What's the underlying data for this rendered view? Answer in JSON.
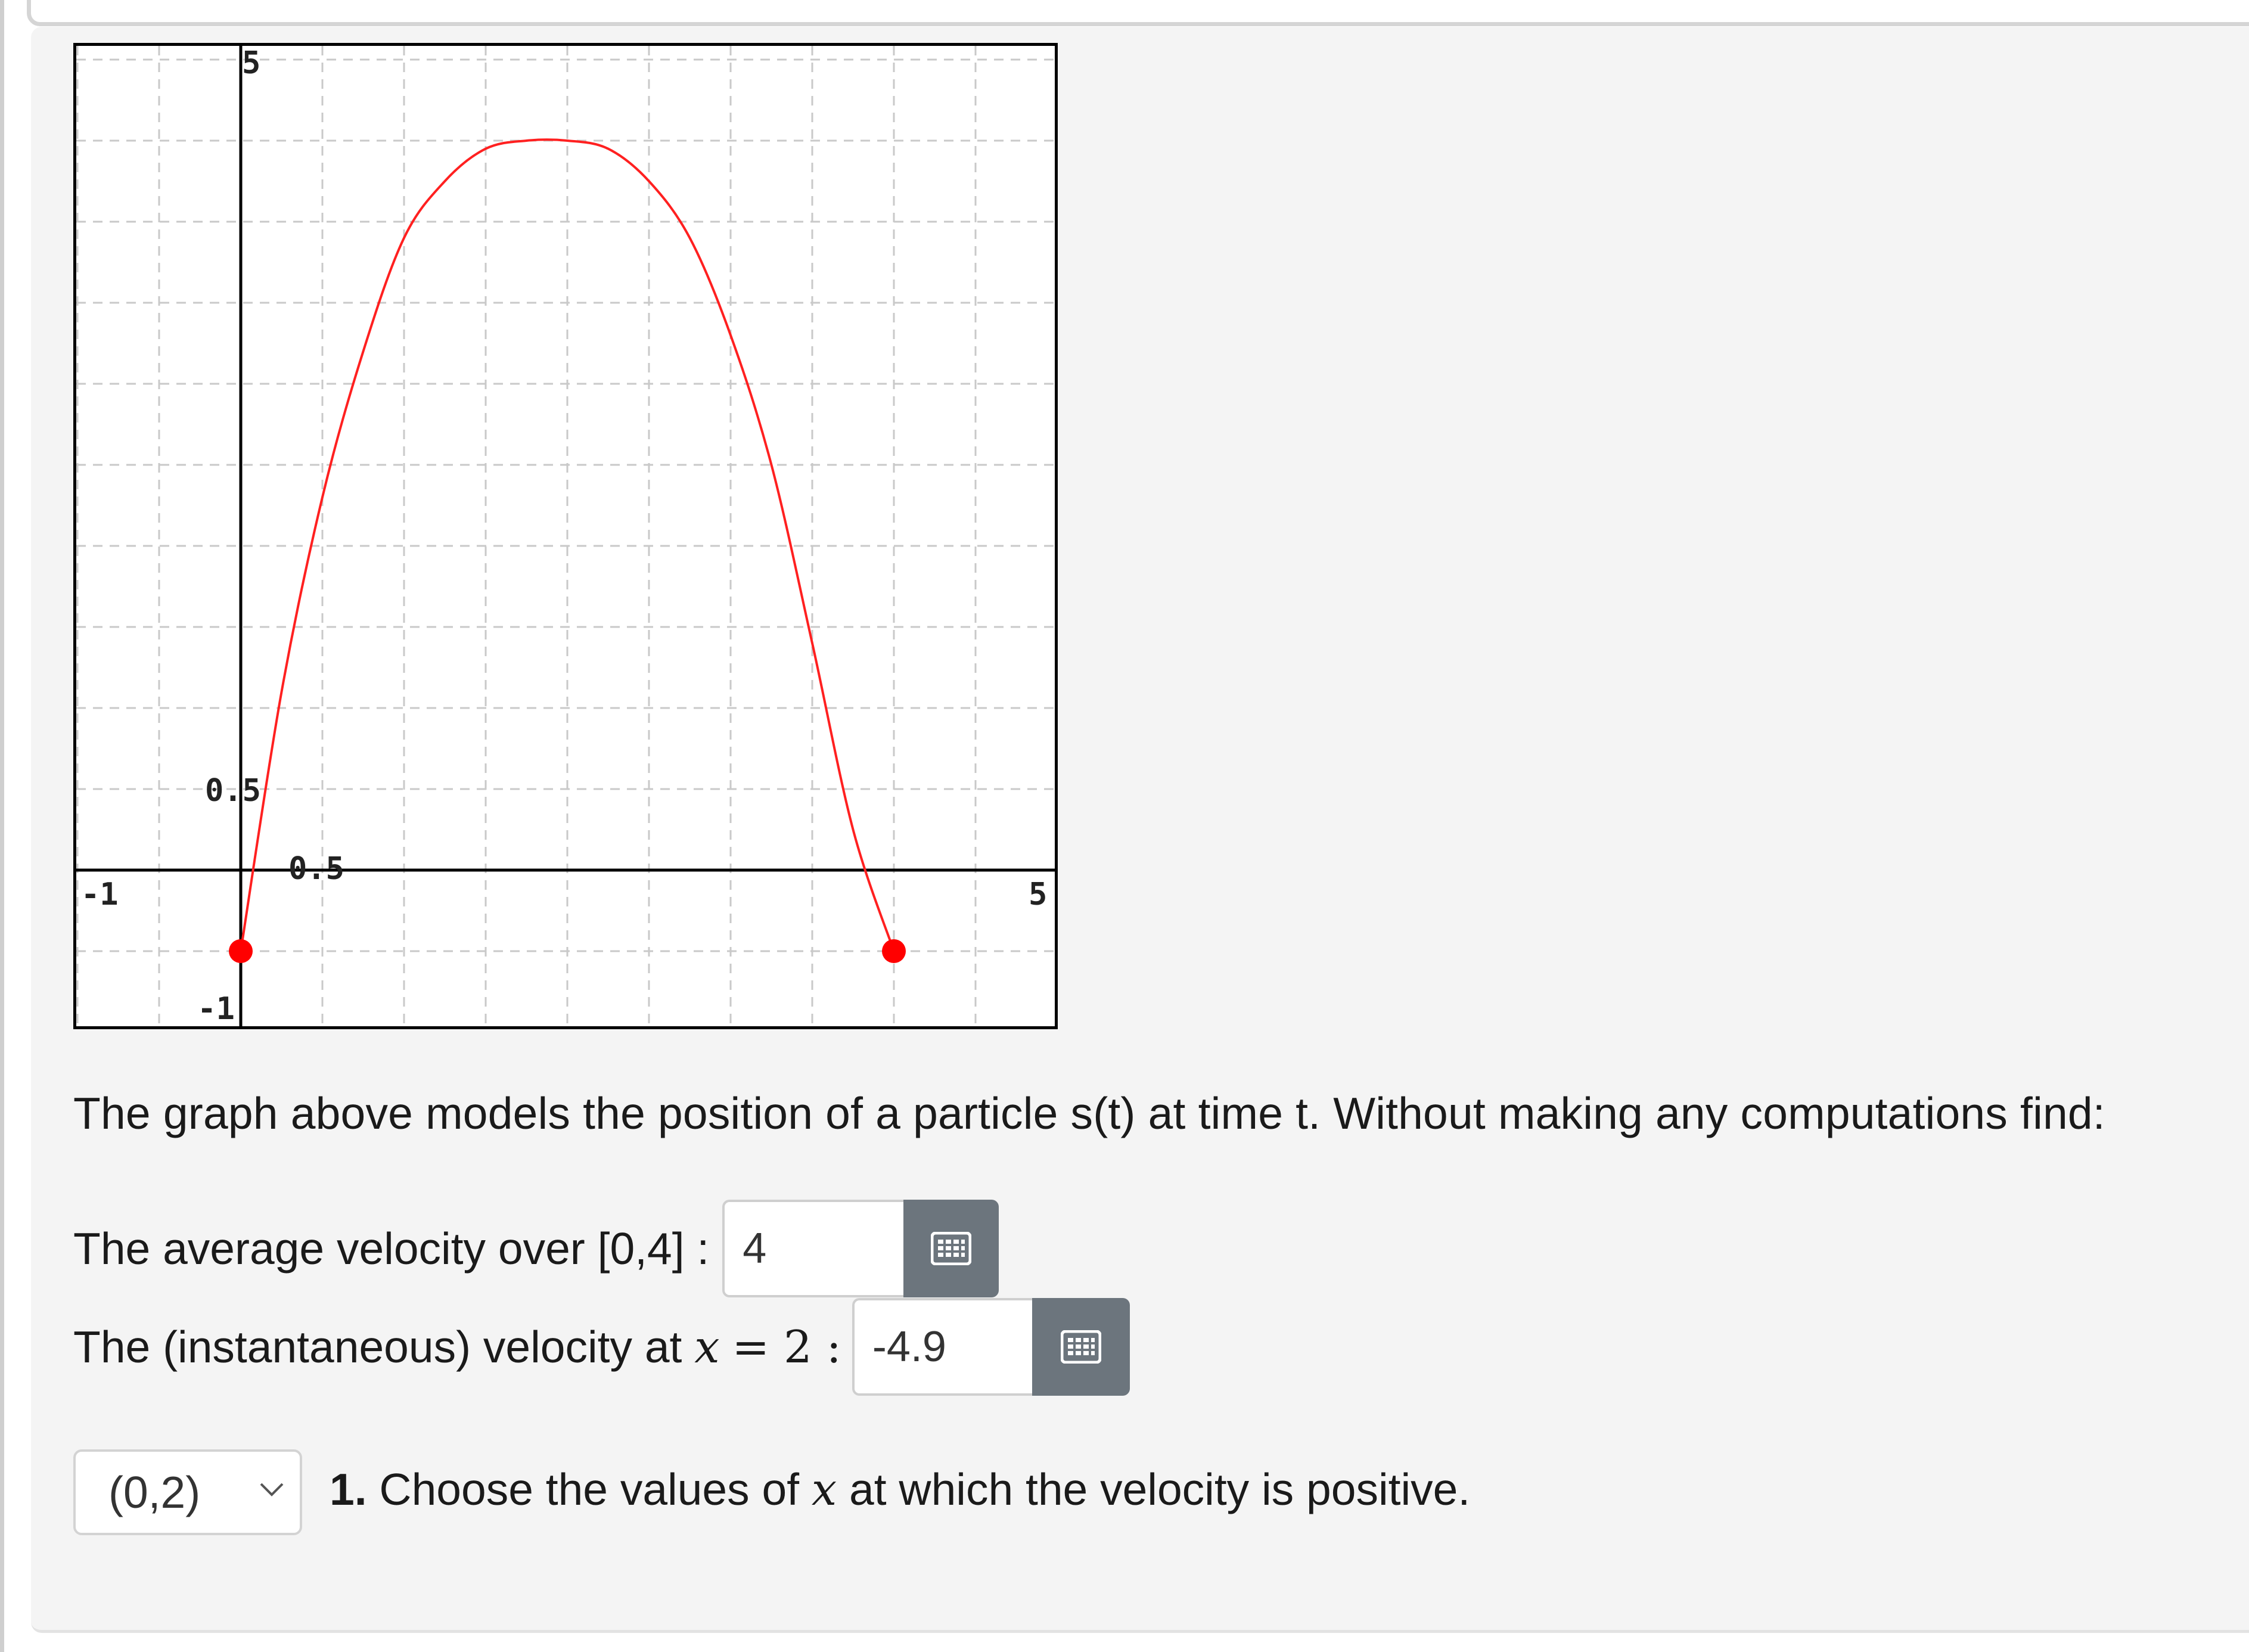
{
  "graph": {
    "x_range": [
      -1,
      5
    ],
    "y_range": [
      -1,
      5
    ],
    "grid": true,
    "tick_labels": {
      "y_top": "5",
      "y_bottom": "-1",
      "y_mid": "0.5",
      "x_left": "-1",
      "x_right": "5",
      "x_mid": "0.5"
    },
    "curve_color": "#ff2020",
    "endpoint_color": "#ff0000"
  },
  "chart_data": {
    "type": "line",
    "title": "",
    "xlabel": "",
    "ylabel": "",
    "xlim": [
      -1,
      5
    ],
    "ylim": [
      -1,
      5
    ],
    "grid": true,
    "series": [
      {
        "x": [
          0,
          0.25,
          0.5,
          0.75,
          1,
          1.25,
          1.5,
          1.75,
          2,
          2.25,
          2.5,
          2.75,
          3,
          3.25,
          3.5,
          3.75,
          4
        ],
        "y": [
          -0.5,
          1.1,
          2.3,
          3.2,
          3.9,
          4.25,
          4.45,
          4.5,
          4.5,
          4.45,
          4.25,
          3.9,
          3.3,
          2.5,
          1.4,
          0.25,
          -0.5
        ]
      }
    ],
    "endpoints": [
      {
        "x": 0,
        "y": -0.5
      },
      {
        "x": 4,
        "y": -0.5
      }
    ]
  },
  "prompt": "The graph above models the position of a particle s(t) at time t. Without making any computations find:",
  "avg_velocity": {
    "label": "The average velocity over [0,4] :",
    "value": "4"
  },
  "inst_velocity": {
    "label_prefix": "The (instantaneous) velocity at",
    "var": "x",
    "equals": "= 2 :",
    "value": "-4.9"
  },
  "positive_velocity": {
    "selected": "(0,2)",
    "number": "1.",
    "text_prefix": " Choose the values of",
    "var": "x",
    "text_suffix": "at which the velocity is positive."
  },
  "icons": {
    "tool_button": "keypad-icon",
    "select_arrow": "chevron-down-icon"
  }
}
